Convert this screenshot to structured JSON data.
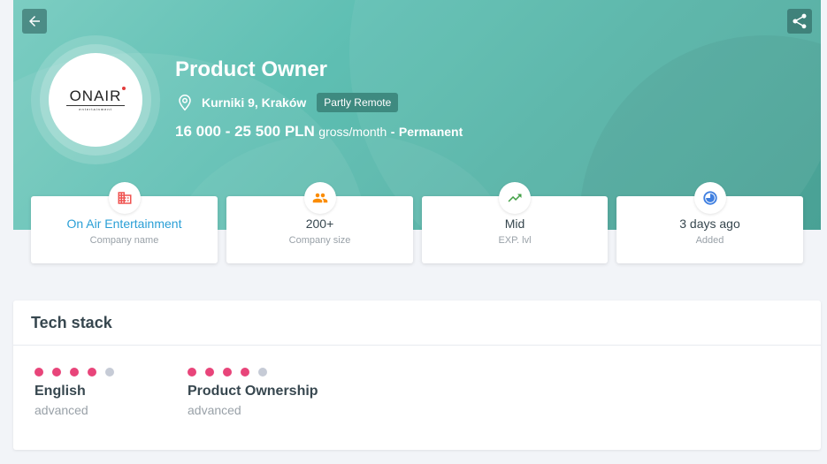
{
  "header": {
    "job_title": "Product Owner",
    "location": "Kurniki 9, Kraków",
    "remote_badge": "Partly Remote",
    "salary_amount": "16 000 - 25 500 PLN",
    "salary_period": "gross/month",
    "salary_separator": "-",
    "employment_type": "Permanent",
    "logo_text": "ONAIR",
    "logo_subtext": "entertainment",
    "accent_color": "#5fbfb3"
  },
  "toolbar": {
    "back_icon": "arrow-left-icon",
    "share_icon": "share-icon"
  },
  "info_cards": [
    {
      "value": "On Air Entertainment",
      "label": "Company name",
      "icon": "building-icon",
      "icon_color": "#ef5350"
    },
    {
      "value": "200+",
      "label": "Company size",
      "icon": "people-icon",
      "icon_color": "#fb8c00"
    },
    {
      "value": "Mid",
      "label": "EXP. lvl",
      "icon": "trending-up-icon",
      "icon_color": "#43a047"
    },
    {
      "value": "3 days ago",
      "label": "Added",
      "icon": "clock-icon",
      "icon_color": "#3f7fe0"
    }
  ],
  "tech_stack": {
    "title": "Tech stack",
    "skills": [
      {
        "name": "English",
        "level": "advanced",
        "rating": 4,
        "max": 5
      },
      {
        "name": "Product Ownership",
        "level": "advanced",
        "rating": 4,
        "max": 5
      }
    ]
  }
}
